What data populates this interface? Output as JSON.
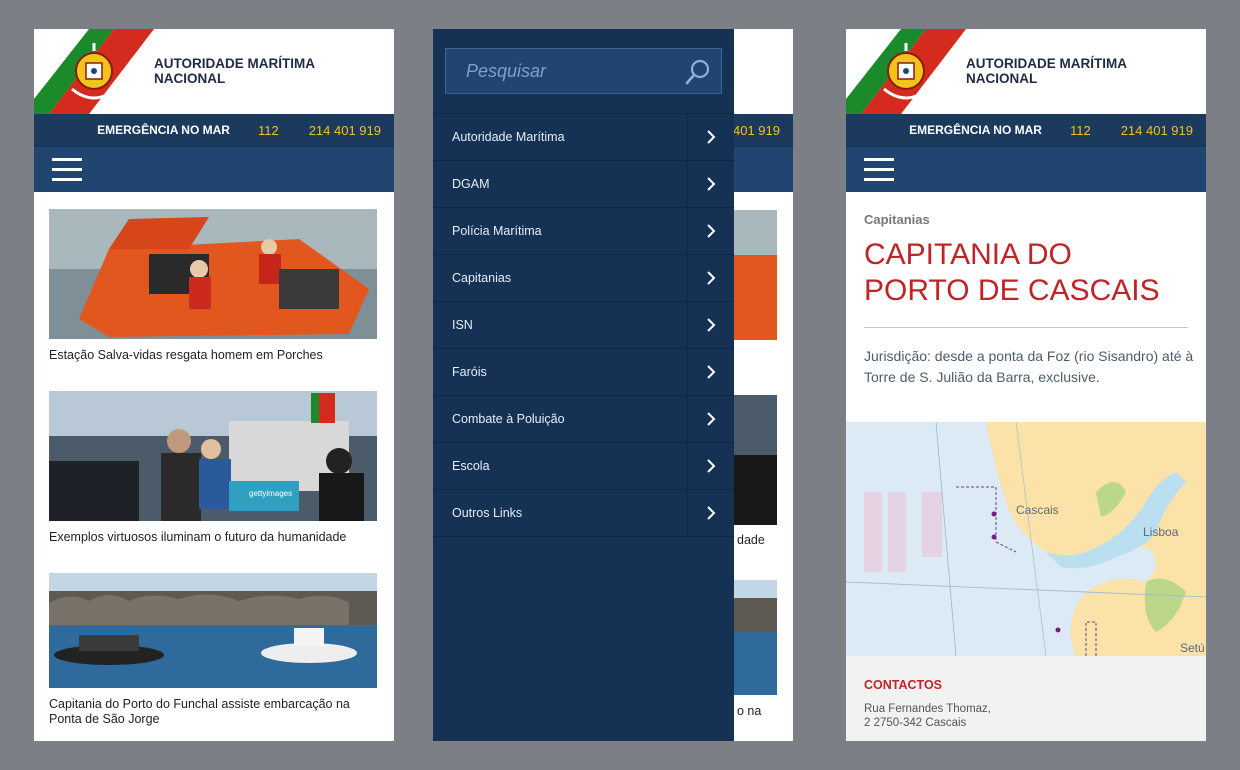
{
  "header": {
    "brand_line1": "AUTORIDADE MARÍTIMA",
    "brand_line2": "NACIONAL",
    "emergency_label": "EMERGÊNCIA NO MAR",
    "phone_short": "112",
    "phone_long": "214 401 919"
  },
  "colors": {
    "navy": "#1b3a5e",
    "nav_blue": "#1f4570",
    "drawer": "#153255",
    "accent_yellow": "#f2c318",
    "accent_red": "#c02426",
    "flag_green": "#1a8a2a",
    "flag_red": "#d52b1e"
  },
  "news": [
    {
      "caption": "Estação Salva-vidas resgata homem em Porches"
    },
    {
      "caption": "Exemplos virtuosos iluminam o futuro da humanidade",
      "watermark": "gettyimages"
    },
    {
      "caption": "Capitania do Porto do Funchal assiste embarcação na Ponta de São Jorge"
    }
  ],
  "drawer": {
    "search_placeholder": "Pesquisar",
    "items": [
      {
        "label": "Autoridade Marítima"
      },
      {
        "label": "DGAM"
      },
      {
        "label": "Polícia Marítima"
      },
      {
        "label": "Capitanias"
      },
      {
        "label": "ISN"
      },
      {
        "label": "Faróis"
      },
      {
        "label": "Combate à Poluição"
      },
      {
        "label": "Escola"
      },
      {
        "label": "Outros Links"
      }
    ],
    "peek_caption": "dade",
    "peek_caption2": "o na"
  },
  "detail": {
    "breadcrumb": "Capitanias",
    "title": "CAPITANIA DO PORTO DE CASCAIS",
    "jurisdiction": "Jurisdição: desde a ponta da Foz (rio Sisandro) até à Torre de S. Julião da Barra, exclusive.",
    "map_labels": {
      "cascais": "Cascais",
      "lisboa": "Lisboa",
      "setubal": "Setú"
    },
    "contacts_heading": "CONTACTOS",
    "address_line1": "Rua Fernandes Thomaz,",
    "address_line2": "2 2750-342 Cascais"
  }
}
